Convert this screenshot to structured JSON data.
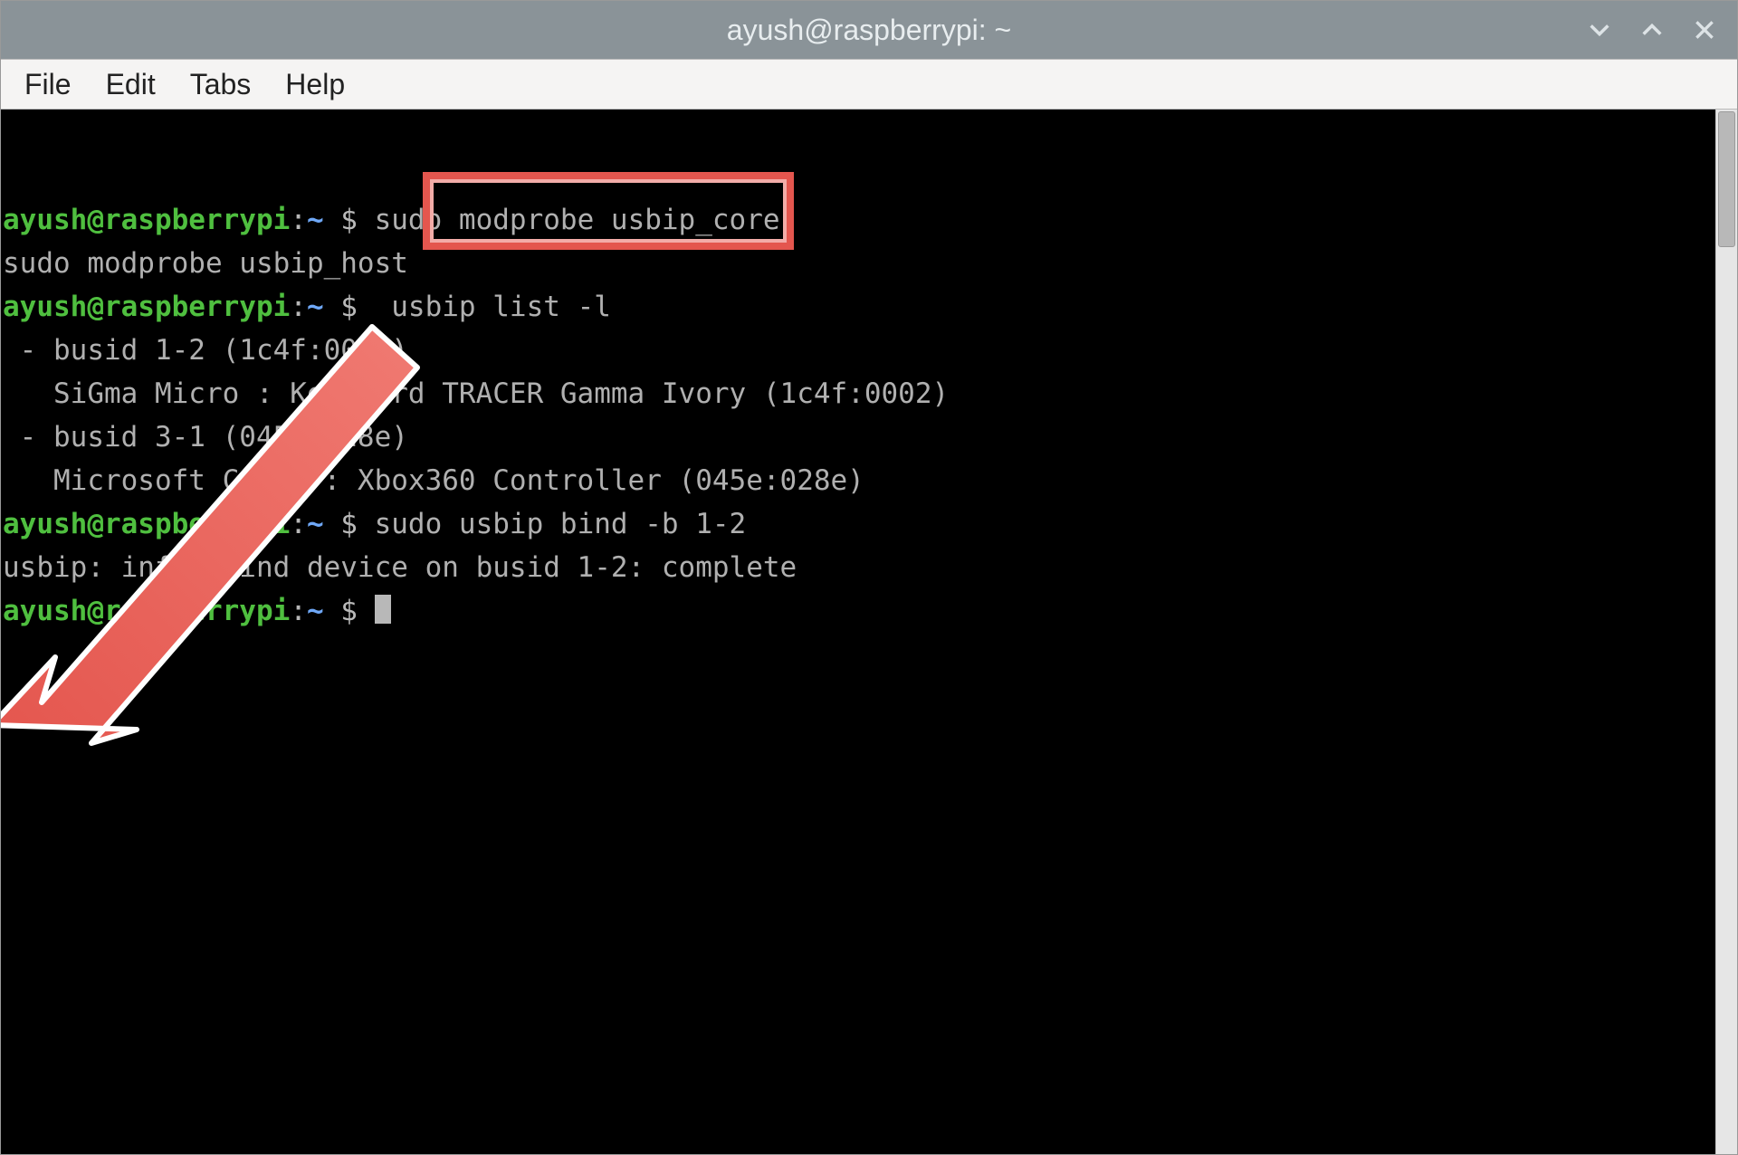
{
  "window": {
    "title": "ayush@raspberrypi: ~"
  },
  "menubar": {
    "items": [
      "File",
      "Edit",
      "Tabs",
      "Help"
    ]
  },
  "prompt": {
    "user_host": "ayush@raspberrypi",
    "sep": ":",
    "path": "~",
    "symbol": "$"
  },
  "terminal": {
    "lines": [
      {
        "type": "cmd",
        "text": "sudo modprobe usbip_core"
      },
      {
        "type": "out",
        "text": "sudo modprobe usbip_host"
      },
      {
        "type": "cmd",
        "text": " usbip list -l"
      },
      {
        "type": "out",
        "text": " - busid 1-2 (1c4f:0002)"
      },
      {
        "type": "out",
        "text": "   SiGma Micro : Keyboard TRACER Gamma Ivory (1c4f:0002)"
      },
      {
        "type": "out",
        "text": ""
      },
      {
        "type": "out",
        "text": " - busid 3-1 (045e:028e)"
      },
      {
        "type": "out",
        "text": "   Microsoft Corp. : Xbox360 Controller (045e:028e)"
      },
      {
        "type": "out",
        "text": ""
      },
      {
        "type": "cmd",
        "text": "sudo usbip bind -b 1-2"
      },
      {
        "type": "out",
        "text": "usbip: info: bind device on busid 1-2: complete"
      },
      {
        "type": "cmd",
        "text": "",
        "cursor": true
      }
    ]
  },
  "annotation": {
    "highlight_command": "usbip list -l",
    "arrow_color": "#e4564e"
  }
}
